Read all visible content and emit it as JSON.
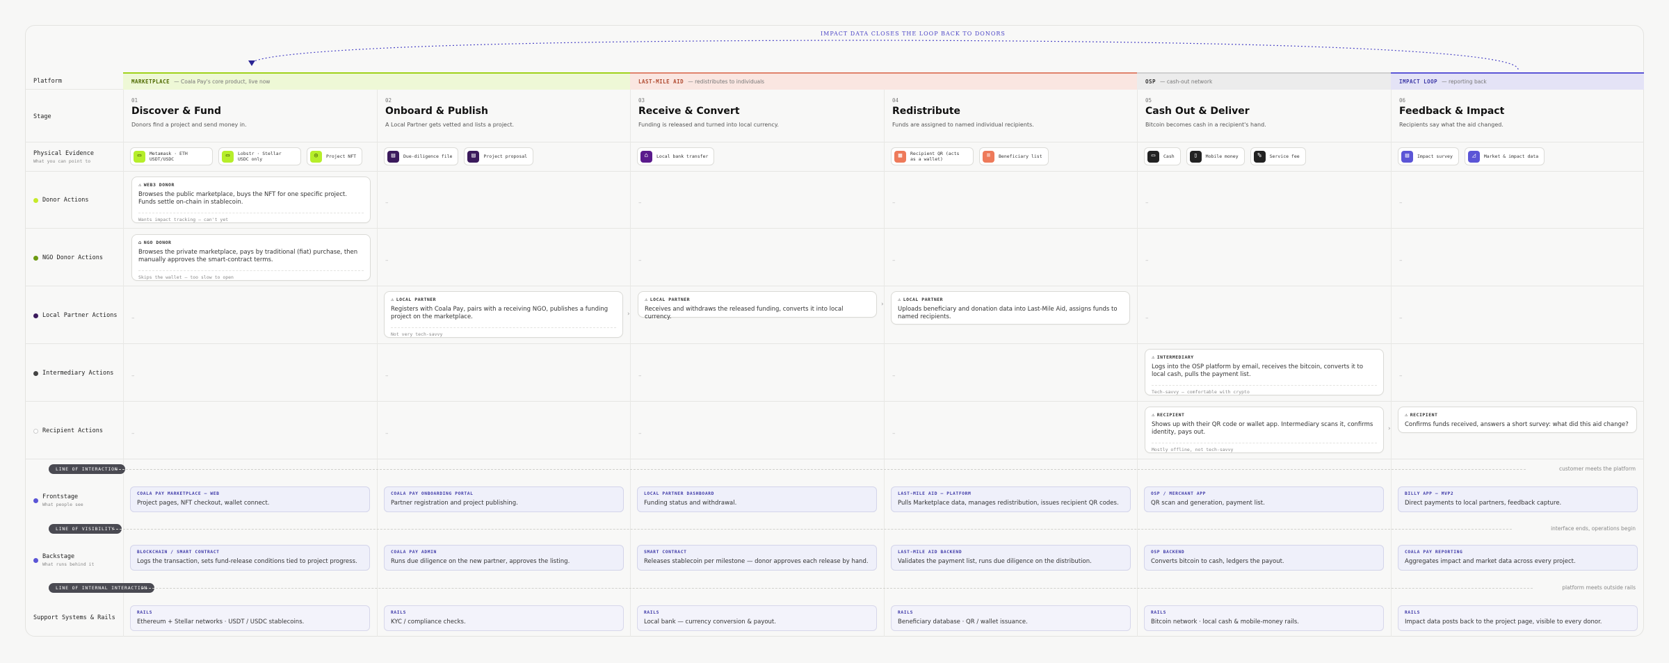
{
  "loop_label": "IMPACT DATA CLOSES THE LOOP BACK TO DONORS",
  "row_labels": {
    "platform": "Platform",
    "stage": "Stage",
    "evidence": "Physical Evidence",
    "evidence_sub": "What you can point to",
    "donor": "Donor Actions",
    "ngo": "NGO Donor Actions",
    "partner": "Local Partner Actions",
    "intermediary": "Intermediary Actions",
    "recipient": "Recipient Actions",
    "frontstage": "Frontstage",
    "frontstage_sub": "What people see",
    "backstage": "Backstage",
    "backstage_sub": "What runs behind it",
    "support": "Support Systems & Rails"
  },
  "platforms": [
    {
      "tag": "MARKETPLACE",
      "desc": "— Coala Pay's core product, live now",
      "color": "#9fd21a",
      "bg": "#eef8d6",
      "tagcolor": "#4e6a00"
    },
    {
      "tag": "LAST-MILE AID",
      "desc": "— redistributes to individuals",
      "color": "#e0826c",
      "bg": "#fae6e1",
      "tagcolor": "#b04a30"
    },
    {
      "tag": "OSP",
      "desc": "— cash-out network",
      "color": "#cfcfcf",
      "bg": "#ececec",
      "tagcolor": "#333333"
    },
    {
      "tag": "IMPACT LOOP",
      "desc": "— reporting back",
      "color": "#5b55d6",
      "bg": "#e4e3f6",
      "tagcolor": "#3f3aa8"
    }
  ],
  "stages": [
    {
      "num": "01",
      "title": "Discover & Fund",
      "desc": "Donors find a project and send money in."
    },
    {
      "num": "02",
      "title": "Onboard & Publish",
      "desc": "A Local Partner gets vetted and lists a project."
    },
    {
      "num": "03",
      "title": "Receive & Convert",
      "desc": "Funding is released and turned into local currency."
    },
    {
      "num": "04",
      "title": "Redistribute",
      "desc": "Funds are assigned to named individual recipients."
    },
    {
      "num": "05",
      "title": "Cash Out & Deliver",
      "desc": "Bitcoin becomes cash in a recipient's hand."
    },
    {
      "num": "06",
      "title": "Feedback & Impact",
      "desc": "Recipients say what the aid changed."
    }
  ],
  "evidence": [
    [
      {
        "label": "Metamask · ETH USDT/USDC",
        "icon": "wallet-icon",
        "glyph": "▭",
        "bg": "#b6ee2a",
        "fg": "#2c3b00"
      },
      {
        "label": "Lobstr · Stellar USDC only",
        "icon": "wallet-icon",
        "glyph": "▭",
        "bg": "#b6ee2a",
        "fg": "#2c3b00"
      },
      {
        "label": "Project NFT",
        "icon": "nft-icon",
        "glyph": "◎",
        "bg": "#b6ee2a",
        "fg": "#2c3b00"
      }
    ],
    [
      {
        "label": "Due-diligence file",
        "icon": "file-icon",
        "glyph": "▤",
        "bg": "#3b1a5c",
        "fg": "#ffffff"
      },
      {
        "label": "Project proposal",
        "icon": "document-icon",
        "glyph": "▤",
        "bg": "#3b1a5c",
        "fg": "#ffffff"
      }
    ],
    [
      {
        "label": "Local bank transfer",
        "icon": "bank-icon",
        "glyph": "⌂",
        "bg": "#5a1a8c",
        "fg": "#ffffff"
      }
    ],
    [
      {
        "label": "Recipient QR (acts as a wallet)",
        "icon": "qr-icon",
        "glyph": "▦",
        "bg": "#ee7a5a",
        "fg": "#ffffff"
      },
      {
        "label": "Beneficiary list",
        "icon": "list-icon",
        "glyph": "≡",
        "bg": "#ee7a5a",
        "fg": "#ffffff"
      }
    ],
    [
      {
        "label": "Cash",
        "icon": "cash-icon",
        "glyph": "▭",
        "bg": "#222222",
        "fg": "#ffffff"
      },
      {
        "label": "Mobile money",
        "icon": "phone-icon",
        "glyph": "▯",
        "bg": "#222222",
        "fg": "#ffffff"
      },
      {
        "label": "Service fee",
        "icon": "percent-icon",
        "glyph": "%",
        "bg": "#222222",
        "fg": "#ffffff"
      }
    ],
    [
      {
        "label": "Impact survey",
        "icon": "survey-icon",
        "glyph": "▤",
        "bg": "#5b55d6",
        "fg": "#ffffff"
      },
      {
        "label": "Market & impact data",
        "icon": "chart-icon",
        "glyph": "◿",
        "bg": "#5b55d6",
        "fg": "#ffffff"
      }
    ]
  ],
  "lane_dots": {
    "donor": "#c6ea2a",
    "ngo": "#6c9a12",
    "partner": "#3b1a5c",
    "intermediary": "#444444",
    "recipient": "#ffffff"
  },
  "empty_mark": "–",
  "flow_arrow": "›",
  "cards": {
    "web3": {
      "role": "WEB3 DONOR",
      "text": "Browses the public marketplace, buys the NFT for one specific project. Funds settle on-chain in stablecoin.",
      "note": "Wants impact tracking — can't yet"
    },
    "ngo": {
      "role": "NGO DONOR",
      "text": "Browses the private marketplace, pays by traditional (fiat) purchase, then manually approves the smart-contract terms.",
      "note": "Skips the wallet — too slow to open"
    },
    "partner2": {
      "role": "LOCAL PARTNER",
      "text": "Registers with Coala Pay, pairs with a receiving NGO, publishes a funding project on the marketplace.",
      "note": "Not very tech-savvy"
    },
    "partner3": {
      "role": "LOCAL PARTNER",
      "text": "Receives and withdraws the released funding, converts it into local currency."
    },
    "partner4": {
      "role": "LOCAL PARTNER",
      "text": "Uploads beneficiary and donation data into Last-Mile Aid, assigns funds to named recipients."
    },
    "intermediary": {
      "role": "INTERMEDIARY",
      "text": "Logs into the OSP platform by email, receives the bitcoin, converts it to local cash, pulls the payment list.",
      "note": "Tech-savvy — comfortable with crypto"
    },
    "recipient5": {
      "role": "RECIPIENT",
      "text": "Shows up with their QR code or wallet app. Intermediary scans it, confirms identity, pays out.",
      "note": "Mostly offline, not tech-savvy"
    },
    "recipient6": {
      "role": "RECIPIENT",
      "text": "Confirms funds received, answers a short survey: what did this aid change?"
    }
  },
  "lines": {
    "interaction": {
      "label": "LINE OF INTERACTION",
      "note": "customer meets the platform"
    },
    "visibility": {
      "label": "LINE OF VISIBILITY",
      "note": "interface ends, operations begin"
    },
    "internal": {
      "label": "LINE OF INTERNAL INTERACTION",
      "note": "platform meets outside rails"
    }
  },
  "frontstage": [
    {
      "h": "COALA PAY MARKETPLACE — WEB",
      "b": "Project pages, NFT checkout, wallet connect."
    },
    {
      "h": "COALA PAY ONBOARDING PORTAL",
      "b": "Partner registration and project publishing."
    },
    {
      "h": "LOCAL PARTNER DASHBOARD",
      "b": "Funding status and withdrawal."
    },
    {
      "h": "LAST-MILE AID — PLATFORM",
      "b": "Pulls Marketplace data, manages redistribution, issues recipient QR codes."
    },
    {
      "h": "OSP / MERCHANT APP",
      "b": "QR scan and generation, payment list."
    },
    {
      "h": "BILLY APP — MVP2",
      "b": "Direct payments to local partners, feedback capture."
    }
  ],
  "backstage": [
    {
      "h": "BLOCKCHAIN / SMART CONTRACT",
      "b": "Logs the transaction, sets fund-release conditions tied to project progress."
    },
    {
      "h": "COALA PAY ADMIN",
      "b": "Runs due diligence on the new partner, approves the listing."
    },
    {
      "h": "SMART CONTRACT",
      "b": "Releases stablecoin per milestone — donor approves each release by hand."
    },
    {
      "h": "LAST-MILE AID BACKEND",
      "b": "Validates the payment list, runs due diligence on the distribution."
    },
    {
      "h": "OSP BACKEND",
      "b": "Converts bitcoin to cash, ledgers the payout."
    },
    {
      "h": "COALA PAY REPORTING",
      "b": "Aggregates impact and market data across every project."
    }
  ],
  "support": [
    {
      "h": "RAILS",
      "b": "Ethereum + Stellar networks · USDT / USDC stablecoins."
    },
    {
      "h": "RAILS",
      "b": "KYC / compliance checks."
    },
    {
      "h": "RAILS",
      "b": "Local bank — currency conversion & payout."
    },
    {
      "h": "RAILS",
      "b": "Beneficiary database · QR / wallet issuance."
    },
    {
      "h": "RAILS",
      "b": "Bitcoin network · local cash & mobile-money rails."
    },
    {
      "h": "RAILS",
      "b": "Impact data posts back to the project page, visible to every donor."
    }
  ]
}
